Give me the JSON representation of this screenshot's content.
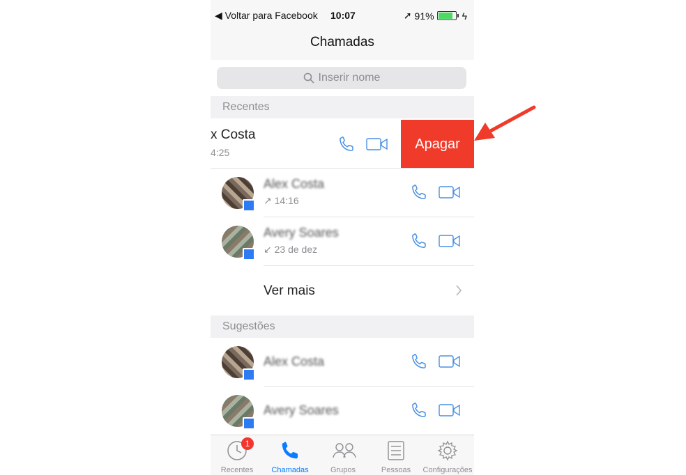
{
  "status": {
    "back_label": "◀ Voltar para Facebook",
    "time": "10:07",
    "battery": "91%"
  },
  "nav": {
    "title": "Chamadas"
  },
  "search": {
    "placeholder": "Inserir nome"
  },
  "sections": {
    "recent": "Recentes",
    "suggestions": "Sugestões"
  },
  "swiped_row": {
    "name": "x Costa",
    "time": "4:25",
    "action_label": "Apagar"
  },
  "recent_rows": [
    {
      "name": "Alex Costa",
      "detail": "↗ 14:16"
    },
    {
      "name": "Avery Soares",
      "detail": "↙ 23 de dez"
    }
  ],
  "see_more": "Ver mais",
  "suggestion_rows": [
    {
      "name": "Alex Costa"
    },
    {
      "name": "Avery Soares"
    }
  ],
  "tabs": [
    {
      "label": "Recentes",
      "badge": "1"
    },
    {
      "label": "Chamadas"
    },
    {
      "label": "Grupos"
    },
    {
      "label": "Pessoas"
    },
    {
      "label": "Configurações"
    }
  ],
  "colors": {
    "accent": "#0a7cff",
    "delete": "#f03a2a",
    "arrow": "#f03a2a"
  }
}
